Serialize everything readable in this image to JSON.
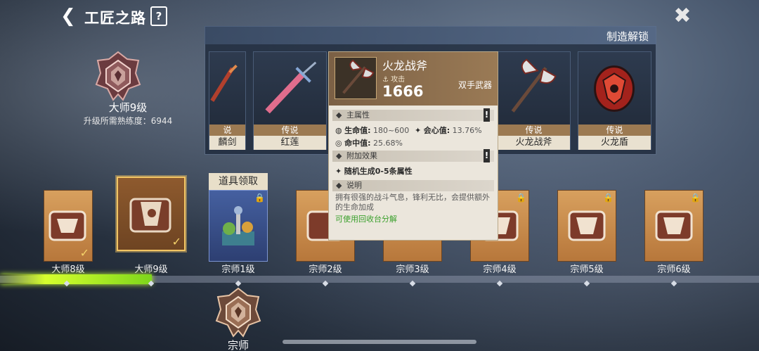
{
  "header": {
    "title": "工匠之路",
    "help_icon": "?",
    "back_icon": "❮",
    "close_icon": "✖"
  },
  "rank": {
    "name": "大师9级",
    "requirement": "升级所需熟练度：6944"
  },
  "unlock_panel": {
    "title": "制造解锁",
    "cards": [
      {
        "rarity": "说",
        "name": "麟剑"
      },
      {
        "rarity": "传说",
        "name": "红莲"
      },
      {
        "rarity": "传说",
        "name": "火龙战斧"
      },
      {
        "rarity": "传说",
        "name": "火龙盾"
      }
    ]
  },
  "tooltip": {
    "name": "火龙战斧",
    "attack_label": "攻击",
    "attack_value": "1666",
    "weapon_type": "双手武器",
    "main_attr_title": "主属性",
    "hp_label": "生命值:",
    "hp_value": "180~600",
    "crit_label": "会心值:",
    "crit_value": "13.76%",
    "hit_label": "命中值:",
    "hit_value": "25.68%",
    "extra_title": "附加效果",
    "extra_text": "随机生成0-5条属性",
    "desc_title": "说明",
    "desc_text": "拥有很强的战斗气息，锋利无比，会提供额外的生命加成",
    "recycle_text": "可使用回收台分解"
  },
  "track": {
    "reward_tag": "道具领取",
    "progress": 0.2,
    "levels": [
      "大师8级",
      "大师9级",
      "宗师1级",
      "宗师2级",
      "宗师3级",
      "宗师4级",
      "宗师5级",
      "宗师6级"
    ],
    "next_rank_name": "宗师"
  },
  "colors": {
    "accent_gold": "#f3c563",
    "progress_green": "#d6ff2e",
    "recycle_green": "#3aa02c"
  }
}
